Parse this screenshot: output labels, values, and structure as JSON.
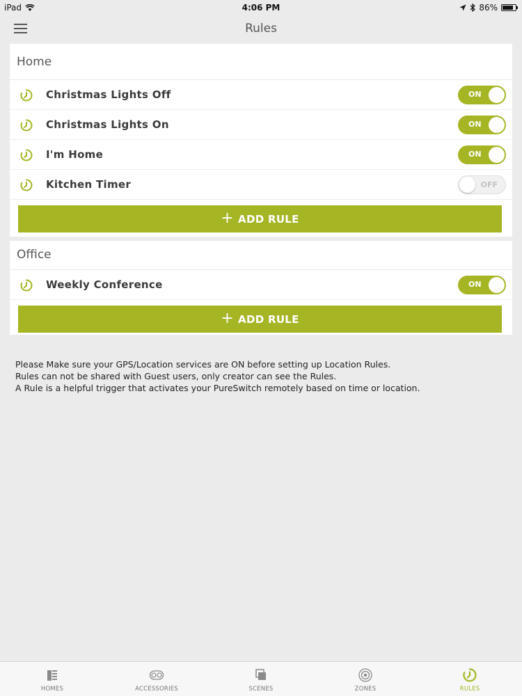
{
  "status_bar": {
    "device": "iPad",
    "time": "4:06 PM",
    "battery": "86%",
    "battery_level": 0.86
  },
  "nav": {
    "title": "Rules",
    "menu_icon": "hamburger-menu-icon"
  },
  "colors": {
    "accent": "#a6b524",
    "background": "#ebebeb",
    "card": "#ffffff"
  },
  "groups": [
    {
      "name": "Home",
      "rules": [
        {
          "name": "Christmas Lights Off",
          "state": "ON"
        },
        {
          "name": "Christmas Lights On",
          "state": "ON"
        },
        {
          "name": "I'm Home",
          "state": "ON"
        },
        {
          "name": "Kitchen Timer",
          "state": "OFF"
        }
      ],
      "add_label": "ADD RULE"
    },
    {
      "name": "Office",
      "rules": [
        {
          "name": "Weekly Conference",
          "state": "ON"
        }
      ],
      "add_label": "ADD RULE"
    }
  ],
  "info": {
    "line1": "Please Make sure your GPS/Location services are ON before setting up Location Rules.",
    "line2": "Rules can not be shared with Guest users, only creator can see the Rules.",
    "line3": "A Rule is a helpful trigger that activates your PureSwitch remotely based on time or location."
  },
  "tabs": [
    {
      "label": "HOMES",
      "icon": "homes-icon",
      "active": false
    },
    {
      "label": "ACCESSORIES",
      "icon": "accessories-icon",
      "active": false
    },
    {
      "label": "SCENES",
      "icon": "scenes-icon",
      "active": false
    },
    {
      "label": "ZONES",
      "icon": "zones-icon",
      "active": false
    },
    {
      "label": "RULES",
      "icon": "rules-icon",
      "active": true
    }
  ]
}
